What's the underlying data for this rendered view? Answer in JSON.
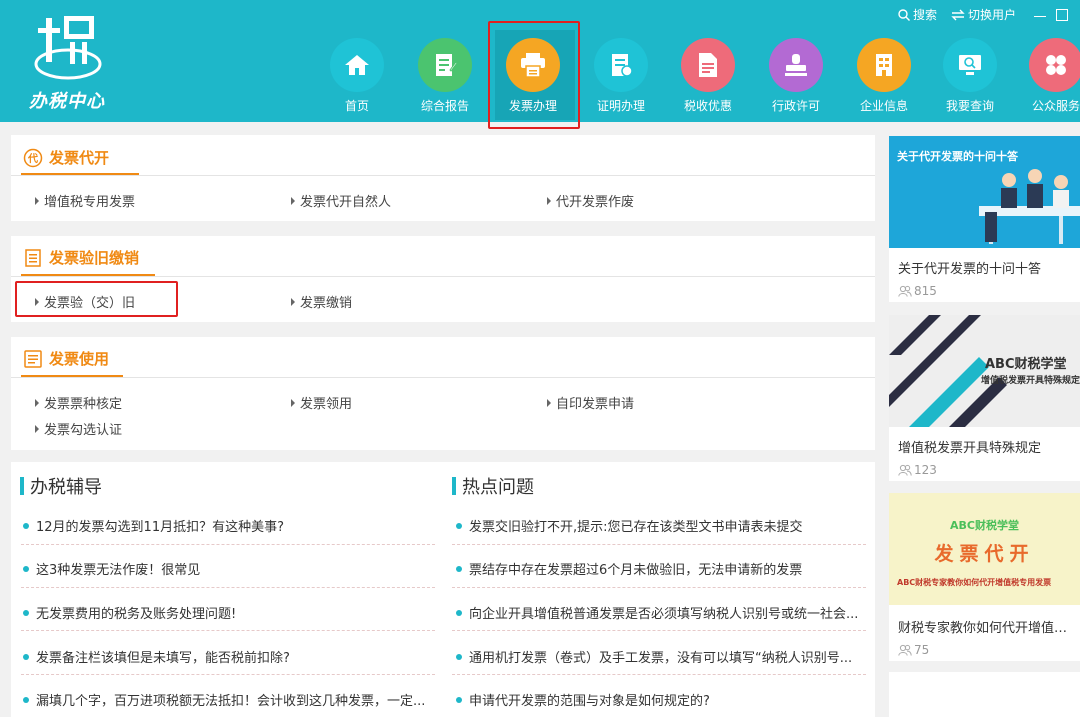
{
  "app": {
    "logo_text": "办税中心",
    "top_links": {
      "search": "搜索",
      "switch_user": "切换用户"
    }
  },
  "nav": [
    {
      "label": "首页",
      "icon": "home-icon",
      "color": "#1fc3d6"
    },
    {
      "label": "综合报告",
      "icon": "report-icon",
      "color": "#4bc46f"
    },
    {
      "label": "发票办理",
      "icon": "printer-icon",
      "color": "#f5a623"
    },
    {
      "label": "证明办理",
      "icon": "certificate-icon",
      "color": "#1fc3d6"
    },
    {
      "label": "税收优惠",
      "icon": "document-icon",
      "color": "#ee6b7a"
    },
    {
      "label": "行政许可",
      "icon": "stamp-icon",
      "color": "#b36ad3"
    },
    {
      "label": "企业信息",
      "icon": "building-icon",
      "color": "#f5a623"
    },
    {
      "label": "我要查询",
      "icon": "monitor-icon",
      "color": "#1fc3d6"
    },
    {
      "label": "公众服务",
      "icon": "grid-icon",
      "color": "#ee6b7a"
    }
  ],
  "sections": {
    "daikai": {
      "title": "发票代开",
      "badge": "代",
      "links": [
        "增值税专用发票",
        "发票代开自然人",
        "代开发票作废"
      ]
    },
    "yanjiu": {
      "title": "发票验旧缴销",
      "links": [
        "发票验（交）旧",
        "发票缴销"
      ]
    },
    "shiyong": {
      "title": "发票使用",
      "links": [
        "发票票种核定",
        "发票领用",
        "自印发票申请",
        "发票勾选认证"
      ]
    }
  },
  "fudao": {
    "title": "办税辅导",
    "items": [
      "12月的发票勾选到11月抵扣？有这种美事?",
      "这3种发票无法作废！很常见",
      "无发票费用的税务及账务处理问题!",
      "发票备注栏该填但是未填写，能否税前扣除?",
      "漏填几个字，百万进项税额无法抵扣！会计收到这几种发票，一定..."
    ]
  },
  "redian": {
    "title": "热点问题",
    "items": [
      "发票交旧验打不开,提示:您已存在该类型文书申请表未提交",
      "票结存中存在发票超过6个月未做验旧，无法申请新的发票",
      "向企业开具增值税普通发票是否必须填写纳税人识别号或统一社会...",
      "通用机打发票（卷式）及手工发票，没有可以填写“纳税人识别号...",
      "申请代开发票的范围与对象是如何规定的?"
    ]
  },
  "cards": [
    {
      "banner": "关于代开发票的十问十答",
      "caption": "关于代开发票的十问十答",
      "views": "815"
    },
    {
      "banner_title": "ABC财税学堂",
      "banner_sub": "增值税发票开具特殊规定",
      "caption": "增值税发票开具特殊规定",
      "views": "123"
    },
    {
      "banner_title": "ABC财税学堂",
      "banner_big": "发票代开",
      "banner_sub": "ABC财税专家教你如何代开增值税专用发票",
      "caption": "财税专家教你如何代开增值税...",
      "views": "75"
    }
  ]
}
